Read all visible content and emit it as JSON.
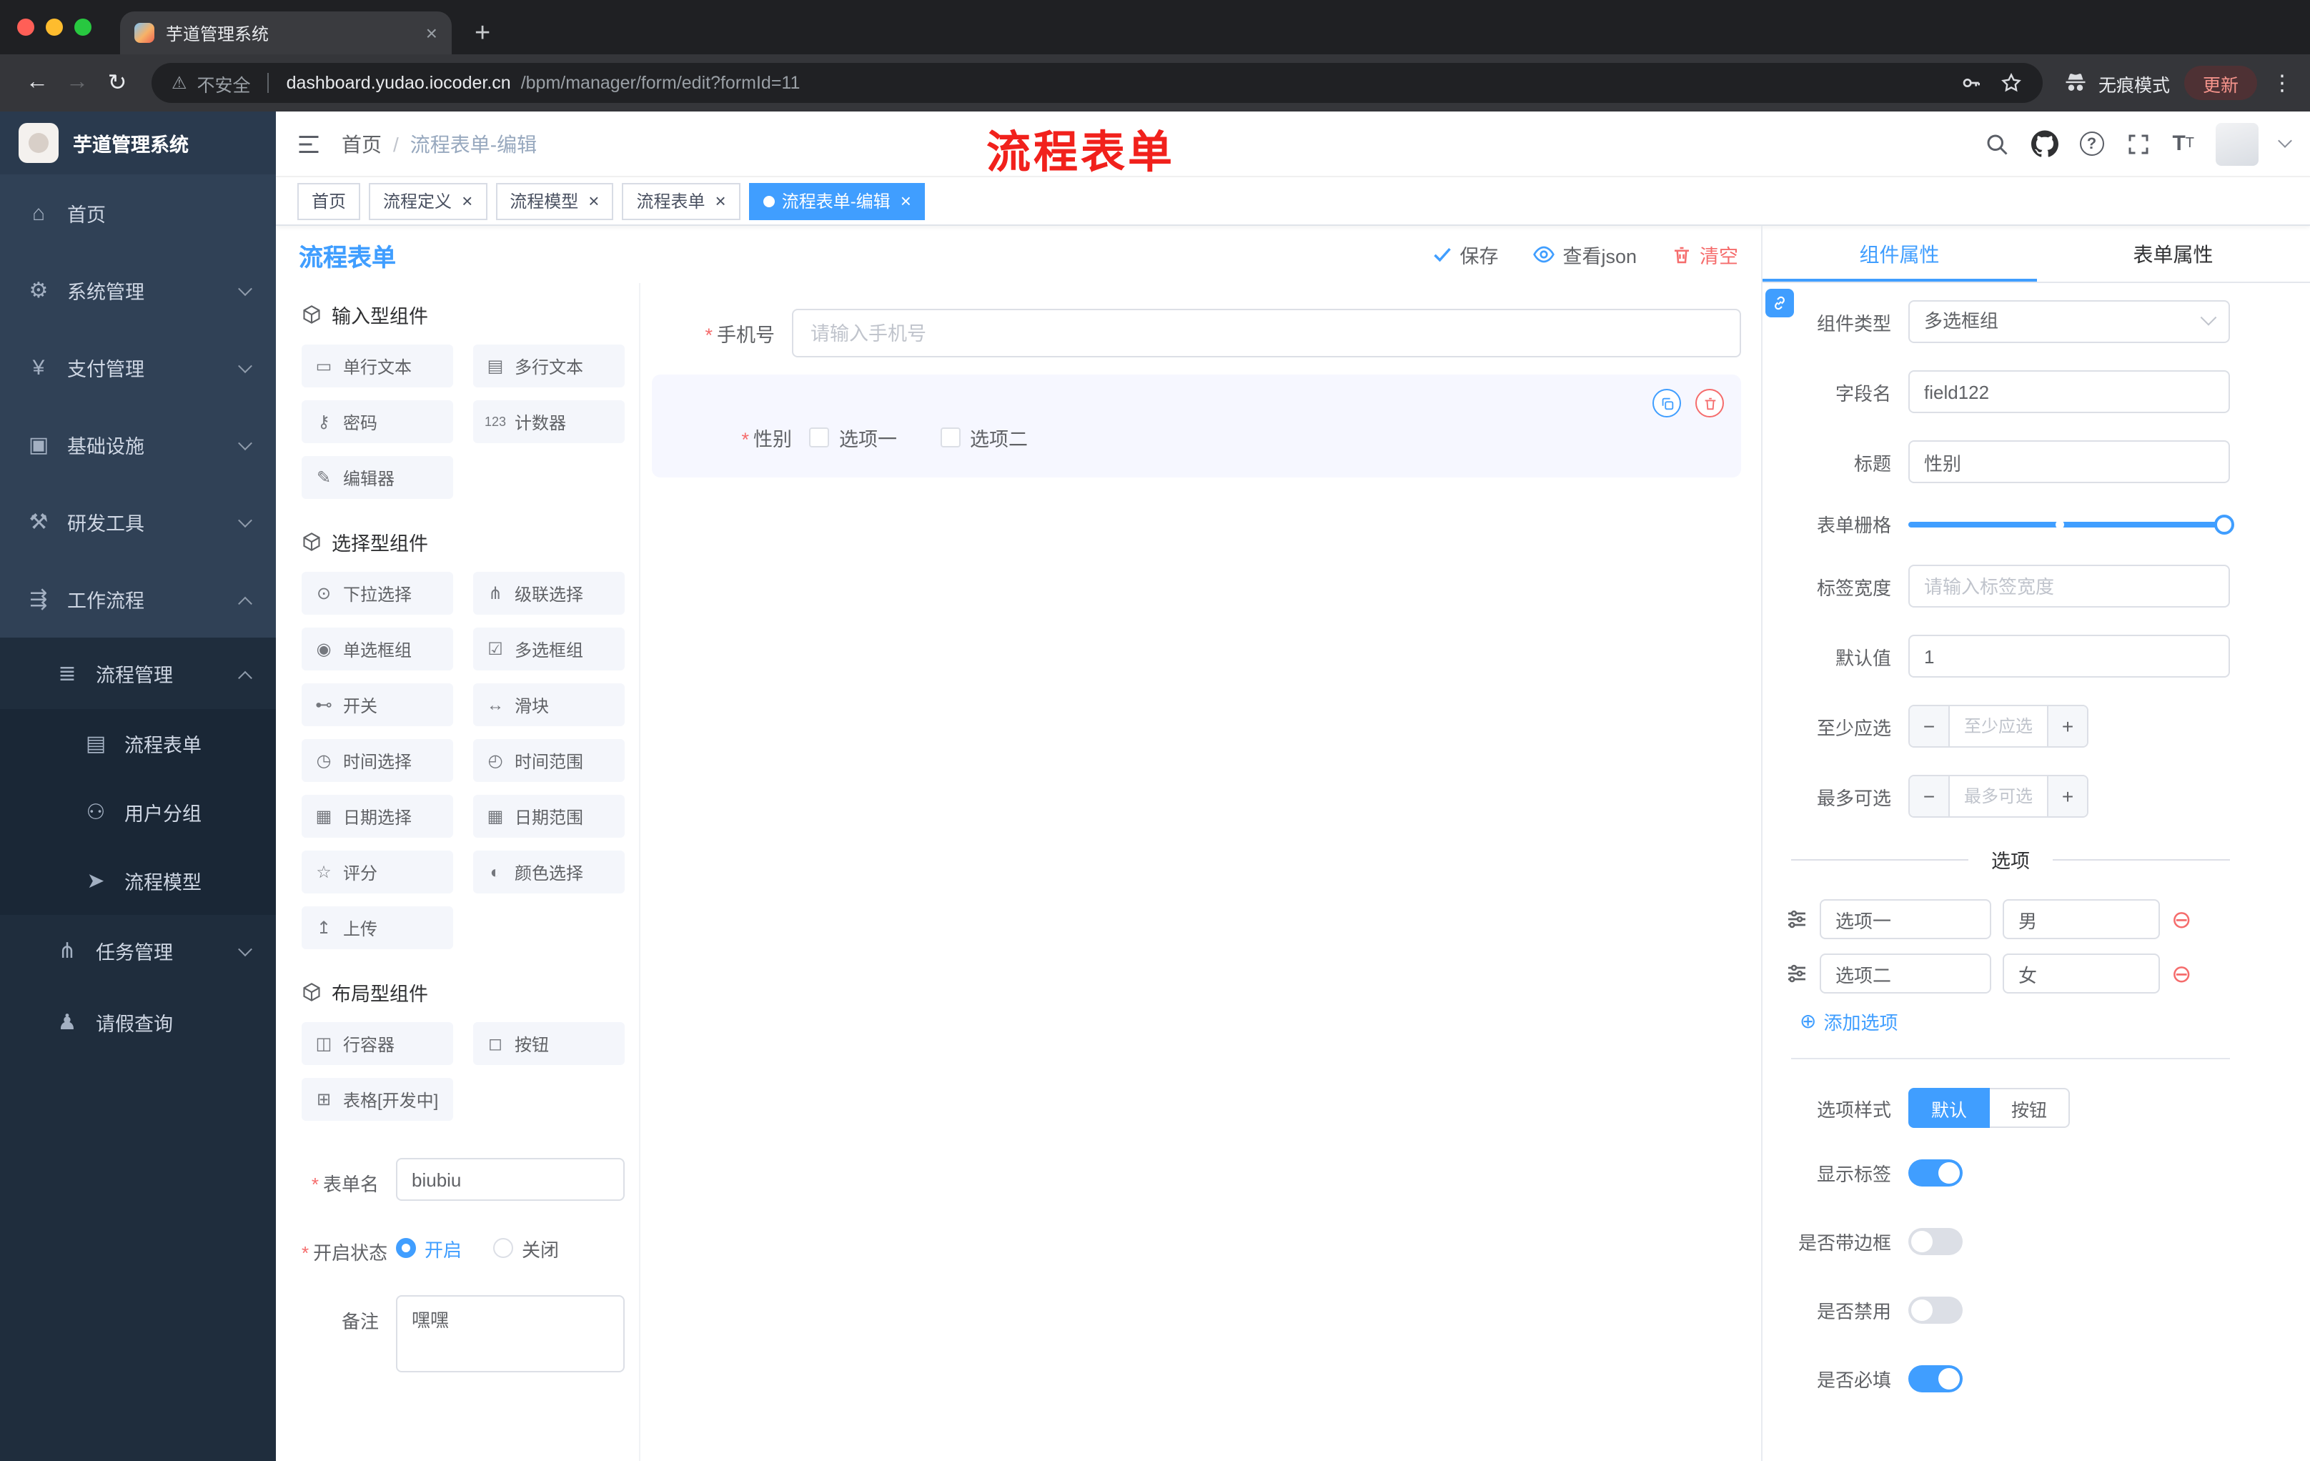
{
  "colors": {
    "primary": "#409eff",
    "danger": "#f56c6c",
    "annotation": "#f1211c"
  },
  "icons": {
    "close": "×",
    "plus": "+",
    "back": "←",
    "forward": "→",
    "reload": "↻",
    "warning": "⚠",
    "kebab": "⋮",
    "slash": "/",
    "asterisk": "*",
    "minus": "−",
    "stepper_plus": "+",
    "add": "⊕",
    "remove": "⊖",
    "question": "?",
    "font_size": "T"
  },
  "browser": {
    "tab_title": "芋道管理系统",
    "security": "不安全",
    "url_domain": "dashboard.yudao.iocoder.cn",
    "url_path": "/bpm/manager/form/edit?formId=11",
    "incognito": "无痕模式",
    "update": "更新"
  },
  "sidebar": {
    "title": "芋道管理系统",
    "menu": [
      {
        "glyph": "⌂",
        "label": "首页"
      },
      {
        "glyph": "⚙",
        "label": "系统管理"
      },
      {
        "glyph": "¥",
        "label": "支付管理"
      },
      {
        "glyph": "▣",
        "label": "基础设施"
      },
      {
        "glyph": "⚒",
        "label": "研发工具"
      },
      {
        "glyph": "⇶",
        "label": "工作流程"
      },
      {
        "glyph": "≣",
        "label": "流程管理"
      },
      {
        "glyph": "▤",
        "label": "流程表单"
      },
      {
        "glyph": "⚇",
        "label": "用户分组"
      },
      {
        "glyph": "➤",
        "label": "流程模型"
      },
      {
        "glyph": "⋔",
        "label": "任务管理"
      },
      {
        "glyph": "♟",
        "label": "请假查询"
      }
    ]
  },
  "navbar": {
    "breadcrumb_home": "首页",
    "breadcrumb_current": "流程表单-编辑",
    "annotation": "流程表单"
  },
  "tags": [
    {
      "label": "首页"
    },
    {
      "label": "流程定义"
    },
    {
      "label": "流程模型"
    },
    {
      "label": "流程表单"
    },
    {
      "label": "流程表单-编辑"
    }
  ],
  "toolbar": {
    "page_title": "流程表单",
    "save": "保存",
    "view_json": "查看json",
    "clear": "清空"
  },
  "palette": {
    "sections": [
      {
        "title": "输入型组件",
        "items": [
          {
            "glyph": "▭",
            "label": "单行文本"
          },
          {
            "glyph": "▤",
            "label": "多行文本"
          },
          {
            "glyph": "⚷",
            "label": "密码"
          },
          {
            "glyph": "123",
            "label": "计数器"
          },
          {
            "glyph": "✎",
            "label": "编辑器"
          }
        ]
      },
      {
        "title": "选择型组件",
        "items": [
          {
            "glyph": "⊙",
            "label": "下拉选择"
          },
          {
            "glyph": "⋔",
            "label": "级联选择"
          },
          {
            "glyph": "◉",
            "label": "单选框组"
          },
          {
            "glyph": "☑",
            "label": "多选框组"
          },
          {
            "glyph": "⊷",
            "label": "开关"
          },
          {
            "glyph": "↔",
            "label": "滑块"
          },
          {
            "glyph": "◷",
            "label": "时间选择"
          },
          {
            "glyph": "◴",
            "label": "时间范围"
          },
          {
            "glyph": "▦",
            "label": "日期选择"
          },
          {
            "glyph": "▦",
            "label": "日期范围"
          },
          {
            "glyph": "☆",
            "label": "评分"
          },
          {
            "glyph": "◐",
            "label": "颜色选择"
          },
          {
            "glyph": "↥",
            "label": "上传"
          }
        ]
      },
      {
        "title": "布局型组件",
        "items": [
          {
            "glyph": "◫",
            "label": "行容器"
          },
          {
            "glyph": "◻",
            "label": "按钮"
          },
          {
            "glyph": "⊞",
            "label": "表格[开发中]"
          }
        ]
      }
    ]
  },
  "left_form": {
    "name_label": "表单名",
    "name_value": "biubiu",
    "status_label": "开启状态",
    "on": "开启",
    "off": "关闭",
    "remark_label": "备注",
    "remark_value": "嘿嘿"
  },
  "canvas": {
    "phone_label": "手机号",
    "phone_placeholder": "请输入手机号",
    "gender_label": "性别",
    "opt1": "选项一",
    "opt2": "选项二"
  },
  "props": {
    "tab_component": "组件属性",
    "tab_form": "表单属性",
    "type_label": "组件类型",
    "type_value": "多选框组",
    "field_label": "字段名",
    "field_value": "field122",
    "title_label": "标题",
    "title_value": "性别",
    "grid_label": "表单栅格",
    "width_label": "标签宽度",
    "width_placeholder": "请输入标签宽度",
    "default_label": "默认值",
    "default_value": "1",
    "min_label": "至少应选",
    "min_placeholder": "至少应选",
    "max_label": "最多可选",
    "max_placeholder": "最多可选",
    "options_title": "选项",
    "options": [
      {
        "label": "选项一",
        "value": "男"
      },
      {
        "label": "选项二",
        "value": "女"
      }
    ],
    "add_option": "添加选项",
    "style_label": "选项样式",
    "style_default": "默认",
    "style_button": "按钮",
    "t_show": "显示标签",
    "t_border": "是否带边框",
    "t_disabled": "是否禁用",
    "t_required": "是否必填"
  }
}
